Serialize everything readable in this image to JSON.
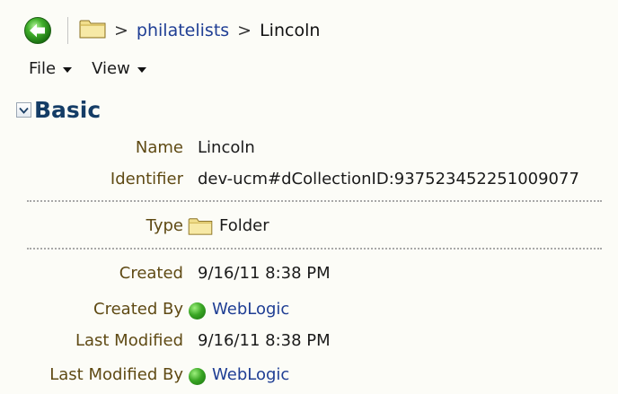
{
  "breadcrumb": {
    "back_icon": "back-arrow-icon",
    "folder_icon": "folder-icon",
    "separator": ">",
    "items": [
      {
        "label": "philatelists",
        "link": true
      },
      {
        "label": "Lincoln",
        "link": false
      }
    ]
  },
  "menubar": {
    "file_label": "File",
    "view_label": "View"
  },
  "section": {
    "title": "Basic",
    "expanded": true
  },
  "properties": {
    "name": {
      "label": "Name",
      "value": "Lincoln"
    },
    "identifier": {
      "label": "Identifier",
      "value": "dev-ucm#dCollectionID:937523452251009077"
    },
    "type": {
      "label": "Type",
      "value": "Folder",
      "icon": "folder-icon"
    },
    "created": {
      "label": "Created",
      "value": "9/16/11 8:38 PM"
    },
    "created_by": {
      "label": "Created By",
      "value": "WebLogic",
      "icon": "user-status-icon",
      "status_color": "#3aa624"
    },
    "last_modified": {
      "label": "Last Modified",
      "value": "9/16/11 8:38 PM"
    },
    "last_modified_by": {
      "label": "Last Modified By",
      "value": "WebLogic",
      "icon": "user-status-icon",
      "status_color": "#3aa624"
    }
  },
  "colors": {
    "background": "#fcfcf7",
    "label": "#5f4a14",
    "link": "#1f3e94",
    "section_title": "#143c66"
  }
}
